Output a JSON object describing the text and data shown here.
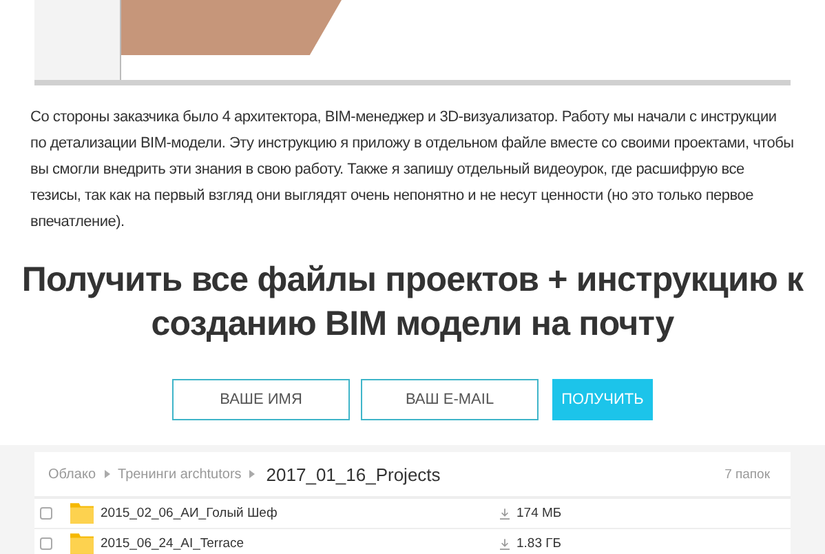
{
  "paragraph": "Со стороны заказчика было 4 архитектора, BIM-менеджер и 3D-визуализатор. Работу мы начали с инструкции по детализации BIM-модели. Эту инструкцию я приложу в отдельном файле вместе со своими проектами, чтобы вы смогли внедрить эти знания в свою работу. Также я запишу отдельный видеоурок, где расшифрую все тезисы, так как на первый взгляд они выглядят очень непонятно и не несут ценности (но это только первое впечатление).",
  "heading": "Получить все файлы проектов + инструкцию к созданию BIM модели на почту",
  "form": {
    "name_placeholder": "ВАШЕ ИМЯ",
    "email_placeholder": "ВАШ E-MAIL",
    "submit": "ПОЛУЧИТЬ"
  },
  "files": {
    "breadcrumbs": [
      "Облако",
      "Тренинги archtutors"
    ],
    "current": "2017_01_16_Projects",
    "count": "7 папок",
    "rows": [
      {
        "name": "2015_02_06_АИ_Голый Шеф",
        "size": "174 МБ",
        "checked": false
      },
      {
        "name": "2015_06_24_AI_Terrace",
        "size": "1.83 ГБ",
        "checked": false
      }
    ]
  }
}
